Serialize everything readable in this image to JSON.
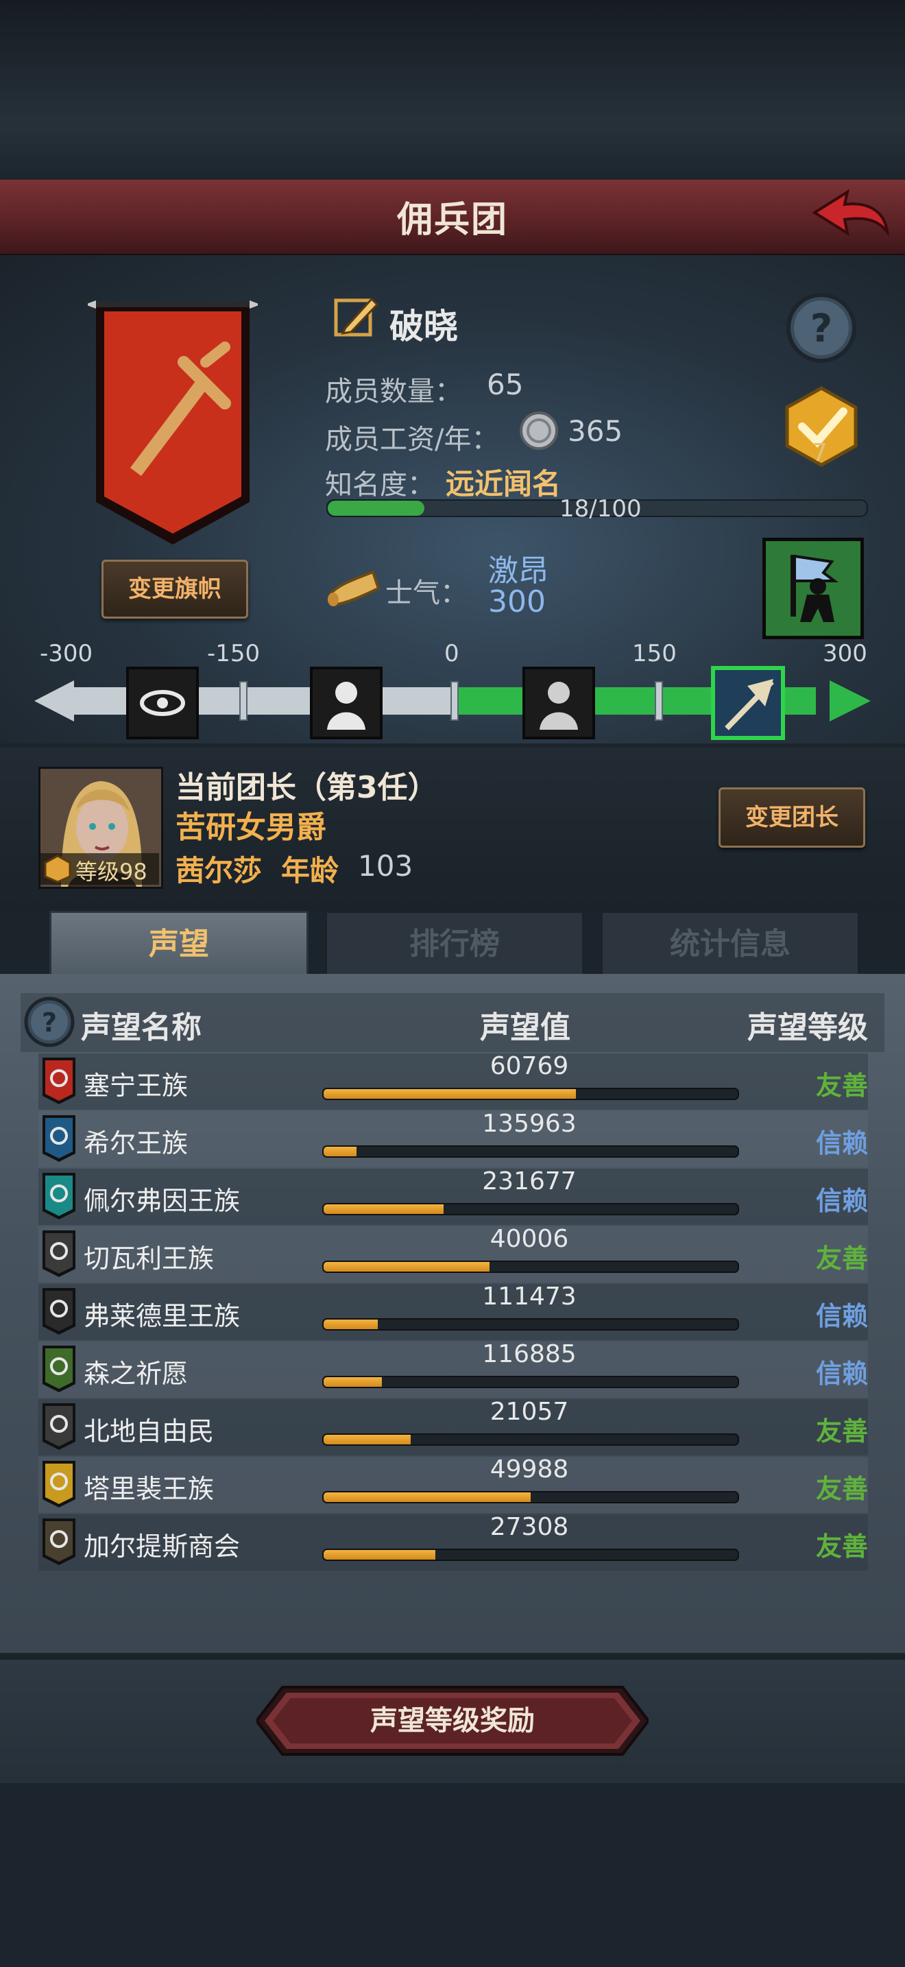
{
  "header": {
    "title": "佣兵团"
  },
  "guild": {
    "name": "破晓",
    "members_label": "成员数量：",
    "members": "65",
    "salary_label": "成员工资/年：",
    "salary": "365",
    "fame_label": "知名度：",
    "fame_value": "远近闻名",
    "fame_progress_text": "18/100",
    "fame_progress": 0.18,
    "change_banner": "变更旗帜",
    "medal_count": "7"
  },
  "morale": {
    "label": "士气：",
    "state": "激昂",
    "value": "300",
    "ticks": [
      "-300",
      "-150",
      "0",
      "150",
      "300"
    ]
  },
  "leader": {
    "title": "当前团长（第3任）",
    "trait": "苦研女男爵",
    "name": "茜尔莎",
    "age_label": "年龄",
    "age": "103",
    "level": "等级98",
    "change_button": "变更团长"
  },
  "tabs": [
    "声望",
    "排行榜",
    "统计信息"
  ],
  "table": {
    "headers": {
      "name": "声望名称",
      "value": "声望值",
      "level": "声望等级"
    },
    "rows": [
      {
        "name": "塞宁王族",
        "value": "60769",
        "level": "友善",
        "fill": 0.61,
        "color": "#b8281f"
      },
      {
        "name": "希尔王族",
        "value": "135963",
        "level": "信赖",
        "fill": 0.08,
        "color": "#1f5a86"
      },
      {
        "name": "佩尔弗因王族",
        "value": "231677",
        "level": "信赖",
        "fill": 0.29,
        "color": "#1a8a86"
      },
      {
        "name": "切瓦利王族",
        "value": "40006",
        "level": "友善",
        "fill": 0.4,
        "color": "#3a3a3a"
      },
      {
        "name": "弗莱德里王族",
        "value": "111473",
        "level": "信赖",
        "fill": 0.13,
        "color": "#2a2a2a"
      },
      {
        "name": "森之祈愿",
        "value": "116885",
        "level": "信赖",
        "fill": 0.14,
        "color": "#3e6b2a"
      },
      {
        "name": "北地自由民",
        "value": "21057",
        "level": "友善",
        "fill": 0.21,
        "color": "#3a3a3a"
      },
      {
        "name": "塔里裴王族",
        "value": "49988",
        "level": "友善",
        "fill": 0.5,
        "color": "#c89a1e"
      },
      {
        "name": "加尔提斯商会",
        "value": "27308",
        "level": "友善",
        "fill": 0.27,
        "color": "#4a4030"
      }
    ],
    "level_colors": {
      "友善": "#5fb33c",
      "信赖": "#6f9fe0"
    }
  },
  "footer": {
    "reward_button": "声望等级奖励"
  }
}
